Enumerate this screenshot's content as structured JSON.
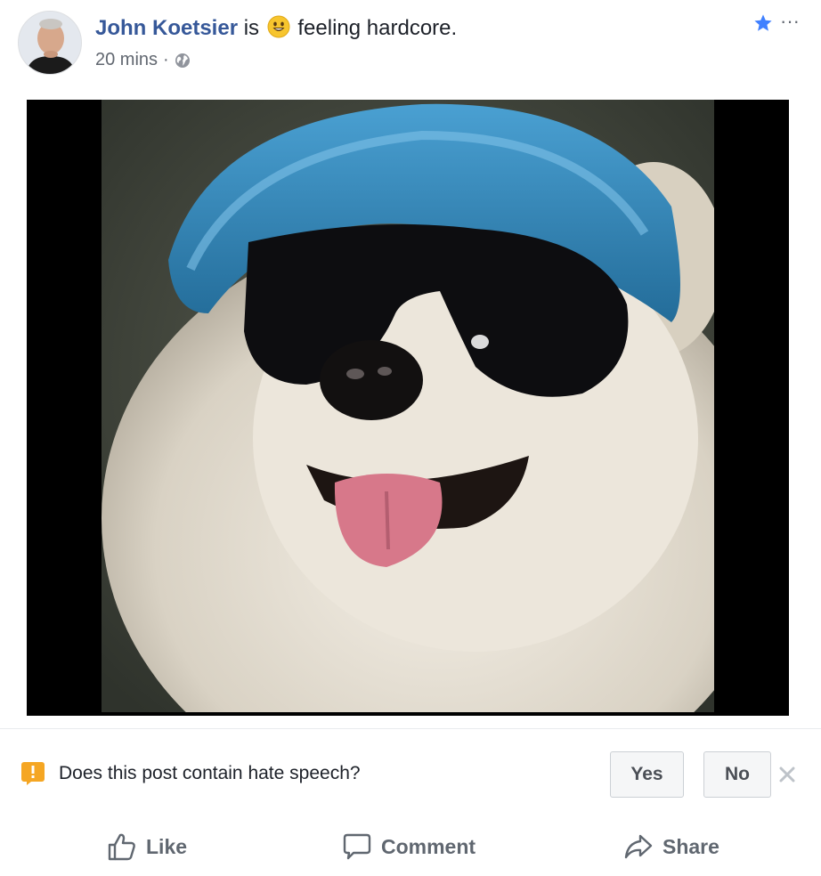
{
  "post": {
    "author_name": "John Koetsier",
    "verb": "is",
    "feeling_icon": "smiley-emoji-icon",
    "feeling_text": "feeling hardcore.",
    "timestamp": "20 mins",
    "separator": "·",
    "audience_icon": "globe-icon"
  },
  "header_actions": {
    "star_icon": "star-icon",
    "more_label": "···"
  },
  "report": {
    "icon": "alert-icon",
    "question": "Does this post contain hate speech?",
    "yes_label": "Yes",
    "no_label": "No",
    "close_icon": "close-icon"
  },
  "actions": {
    "like_label": "Like",
    "comment_label": "Comment",
    "share_label": "Share"
  },
  "colors": {
    "author_link": "#365899",
    "alert_orange": "#f5a623",
    "star_blue": "#4080ff",
    "secondary_text": "#616770"
  }
}
